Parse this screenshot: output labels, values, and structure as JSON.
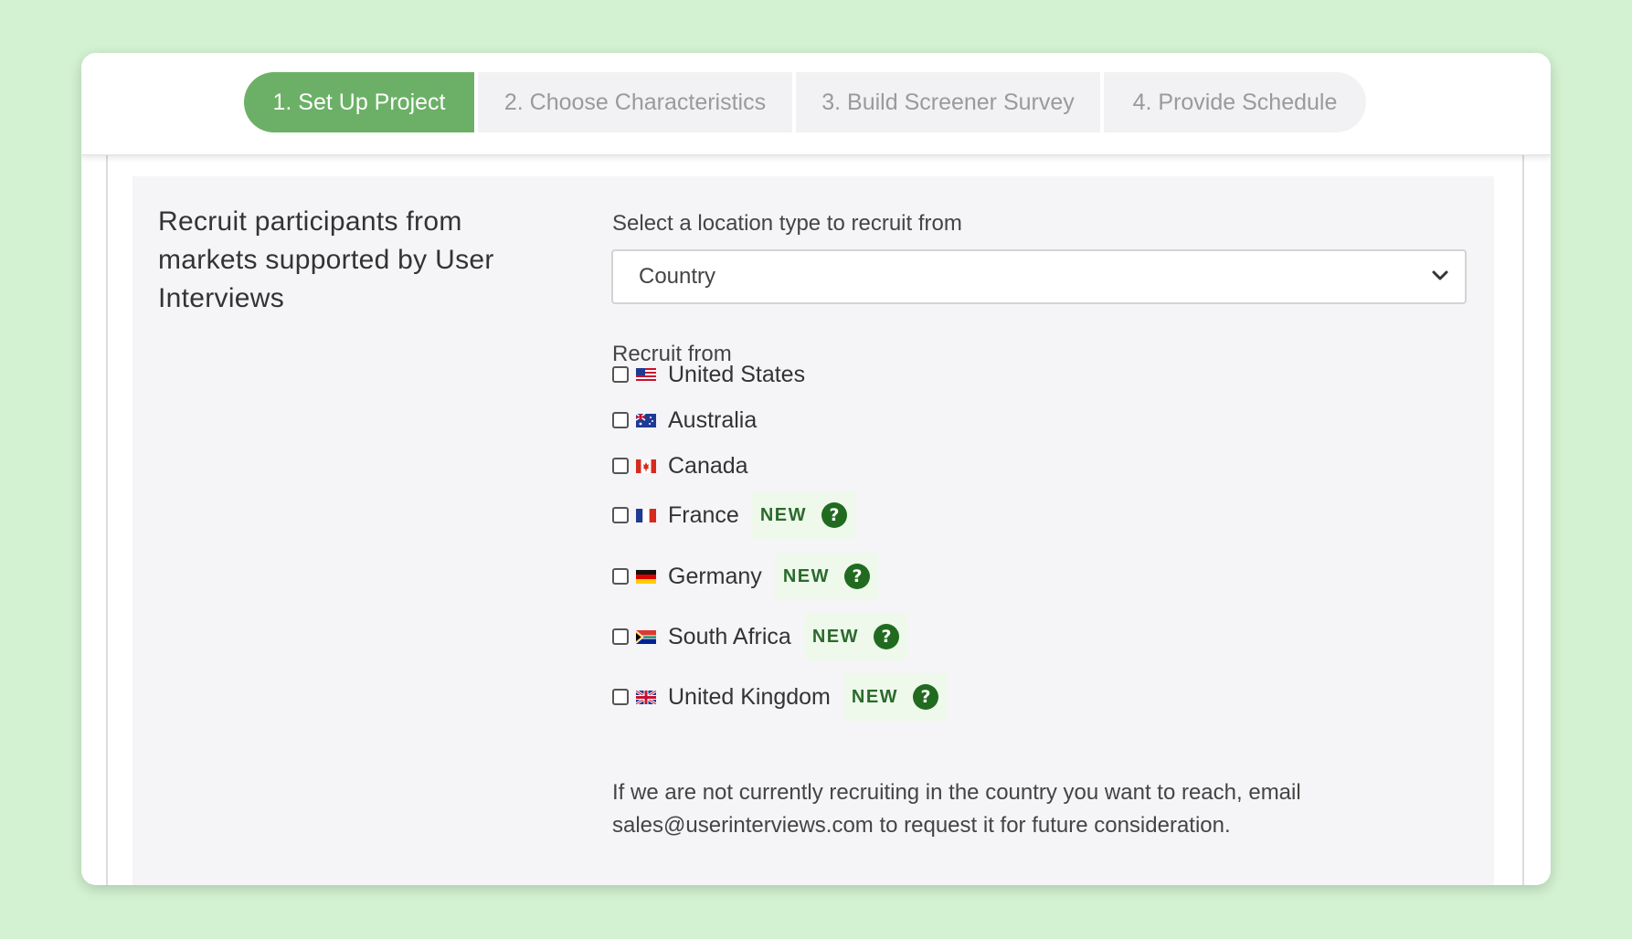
{
  "steps": [
    {
      "label": "1. Set Up Project",
      "active": true
    },
    {
      "label": "2. Choose Characteristics",
      "active": false
    },
    {
      "label": "3. Build Screener Survey",
      "active": false
    },
    {
      "label": "4. Provide Schedule",
      "active": false
    }
  ],
  "intro": {
    "text": "Recruit participants from markets supported by User Interviews"
  },
  "location": {
    "label": "Select a location type to recruit from",
    "selected": "Country",
    "chevron_icon": "chevron-down-icon"
  },
  "recruit": {
    "label": "Recruit from",
    "countries": [
      {
        "name": "United States",
        "checked": false,
        "flag": "us-flag-icon",
        "is_new": false
      },
      {
        "name": "Australia",
        "checked": false,
        "flag": "au-flag-icon",
        "is_new": false
      },
      {
        "name": "Canada",
        "checked": false,
        "flag": "ca-flag-icon",
        "is_new": false
      },
      {
        "name": "France",
        "checked": false,
        "flag": "fr-flag-icon",
        "is_new": true
      },
      {
        "name": "Germany",
        "checked": false,
        "flag": "de-flag-icon",
        "is_new": true
      },
      {
        "name": "South Africa",
        "checked": false,
        "flag": "za-flag-icon",
        "is_new": true
      },
      {
        "name": "United Kingdom",
        "checked": false,
        "flag": "gb-flag-icon",
        "is_new": true
      }
    ],
    "new_badge": "NEW",
    "help_glyph": "?"
  },
  "note": {
    "text": "If we are not currently recruiting in the country you want to reach, email sales@userinterviews.com to request it for future consideration."
  },
  "colors": {
    "background": "#d3f2d1",
    "accent": "#6bb066",
    "badge_text": "#2b6a2b",
    "help_icon": "#216b21"
  }
}
